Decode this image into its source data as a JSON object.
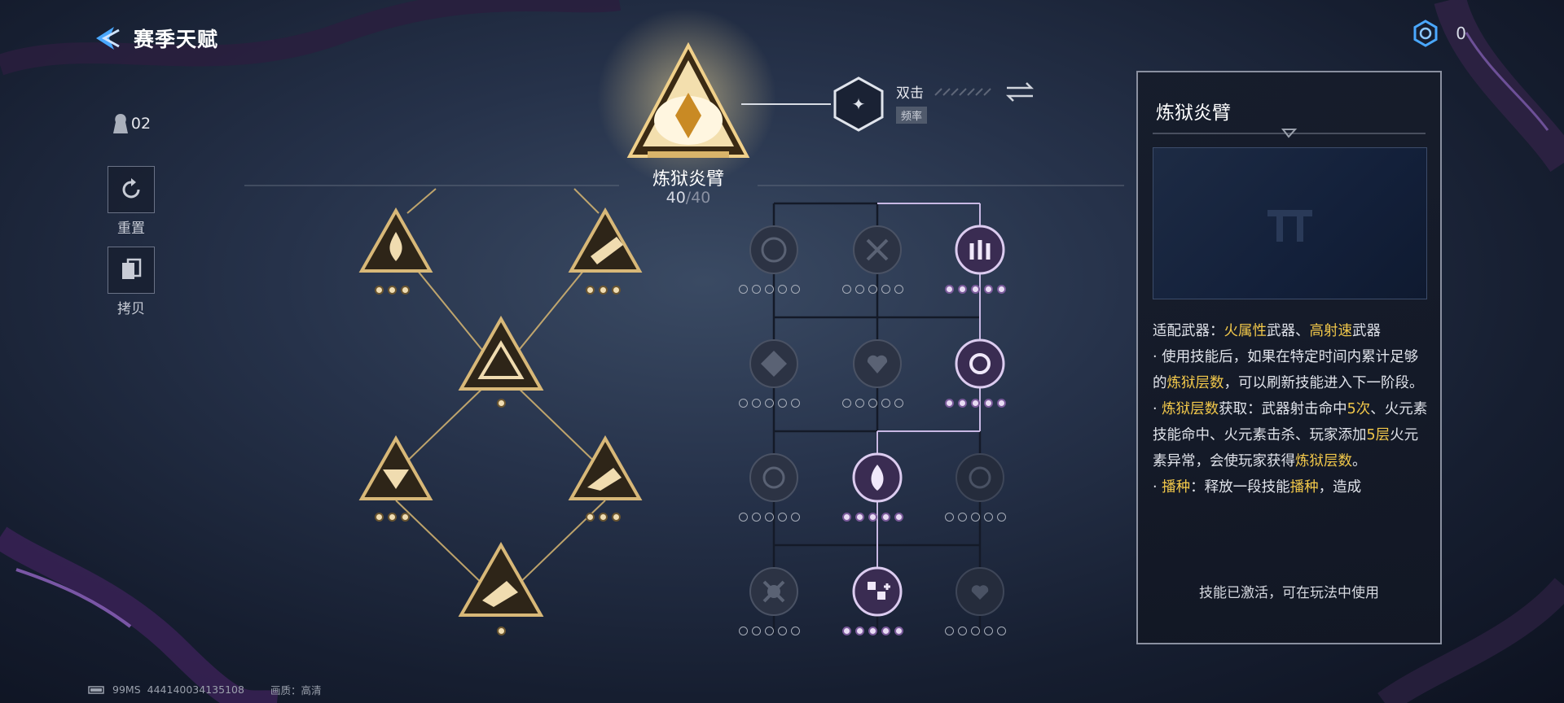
{
  "header": {
    "title": "赛季天赋",
    "back_icon": "back-arrow-icon"
  },
  "currency": {
    "value": "0",
    "icon": "hex-token-icon"
  },
  "tools": {
    "counter": "02",
    "reset_label": "重置",
    "copy_label": "拷贝"
  },
  "top_node": {
    "name": "炼狱炎臂",
    "progress_current": "40",
    "progress_max": "/40"
  },
  "linked_skill": {
    "name": "双击",
    "tag": "频率"
  },
  "panel": {
    "title": "炼狱炎臂",
    "line1_a": "适配武器：",
    "line1_b": "火属性",
    "line1_c": "武器、",
    "line1_d": "高射速",
    "line1_e": "武器",
    "p1_a": "· 使用技能后，如果在特定时间内累计足够的",
    "p1_b": "炼狱层数",
    "p1_c": "，可以刷新技能进入下一阶段。",
    "p2_a": "· ",
    "p2_b": "炼狱层数",
    "p2_c": "获取：武器射击命中",
    "p2_d": "5次",
    "p2_e": "、火元素技能命中、火元素击杀、玩家添加",
    "p2_f": "5层",
    "p2_g": "火元素异常，会使玩家获得",
    "p2_h": "炼狱层数",
    "p2_i": "。",
    "p3_a": "· ",
    "p3_b": "播种",
    "p3_c": "：释放一段技能",
    "p3_d": "播种",
    "p3_e": "，造成",
    "footer": "技能已激活，可在玩法中使用"
  },
  "status_bar": {
    "ping": "99MS",
    "id": "444140034135108",
    "quality": "画质：高清"
  },
  "colors": {
    "gold": "#e8c27a",
    "purple": "#b89ad8",
    "highlight": "#f2c84a"
  }
}
